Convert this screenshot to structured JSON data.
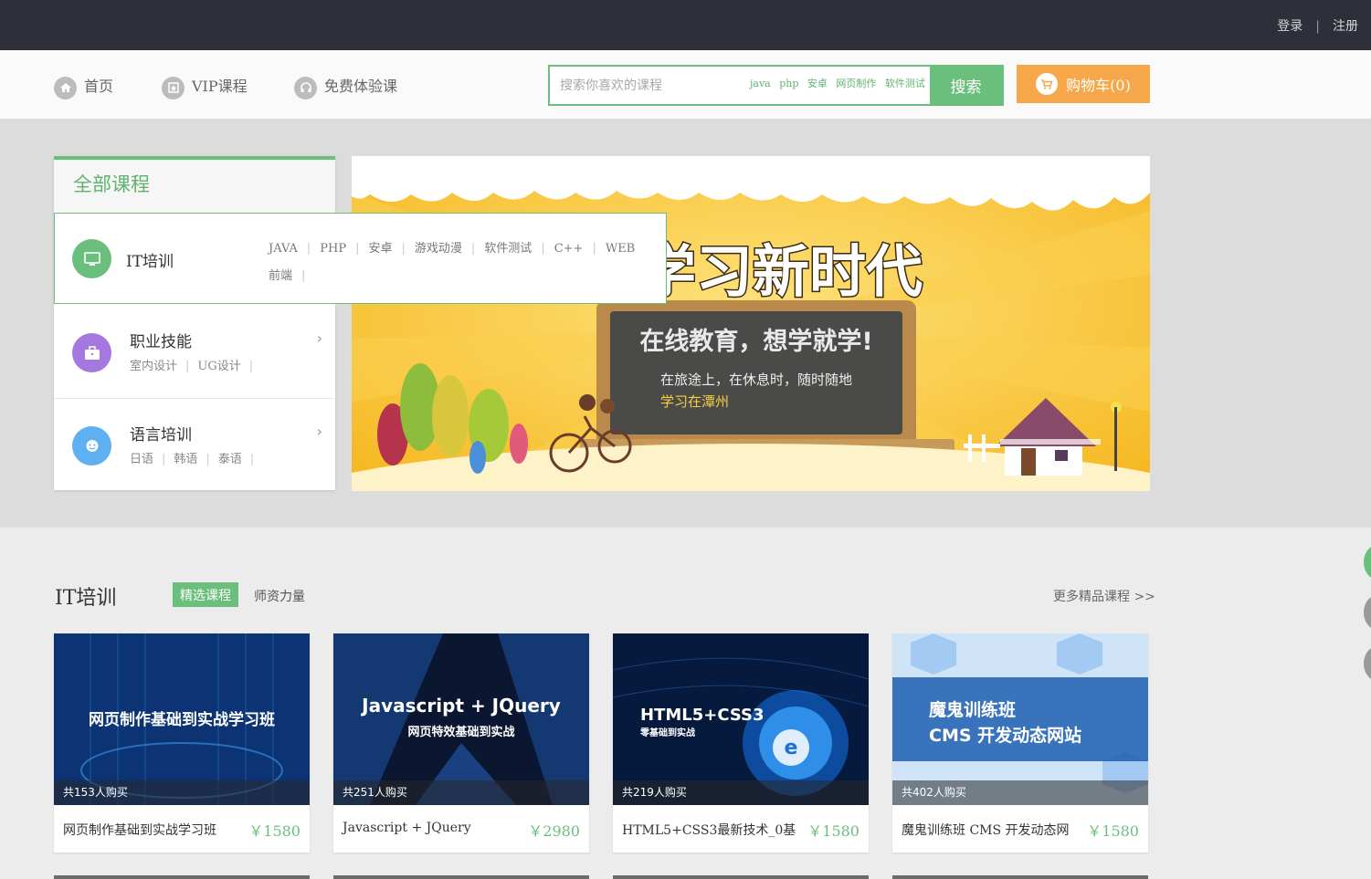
{
  "topbar": {
    "login": "登录",
    "sep": "|",
    "register": "注册"
  },
  "nav": {
    "items": [
      {
        "label": "首页",
        "icon": "home-icon"
      },
      {
        "label": "VIP课程",
        "icon": "vip-icon"
      },
      {
        "label": "免费体验课",
        "icon": "headphones-icon"
      }
    ],
    "search_placeholder": "搜索你喜欢的课程",
    "hot_words": [
      "java",
      "php",
      "安卓",
      "网页制作",
      "软件测试"
    ],
    "search_button": "搜索",
    "cart_label": "购物车(0)"
  },
  "categories": {
    "title": "全部课程",
    "it": {
      "name": "IT培训",
      "subs": [
        "JAVA",
        "PHP",
        "安卓",
        "游戏动漫",
        "软件测试",
        "C++",
        "WEB",
        "前端"
      ]
    },
    "rows": [
      {
        "name": "职业技能",
        "subs": [
          "室内设计",
          "UG设计"
        ],
        "color": "#a578e0"
      },
      {
        "name": "语言培训",
        "subs": [
          "日语",
          "韩语",
          "泰语"
        ],
        "color": "#5fb0f0"
      }
    ]
  },
  "banner": {
    "headline": "学习新时代",
    "slogan": "在线教育，想学就学!",
    "line1": "在旅途上，在休息时，随时随地",
    "line2": "学习在潭州"
  },
  "section": {
    "title": "IT培训",
    "tab_active": "精选课程",
    "tab": "师资力量",
    "more": "更多精品课程 >>"
  },
  "courses": [
    {
      "thumb_title": "网页制作基础到实战学习班",
      "thumb_sub": "",
      "buyers": "共153人购买",
      "name": "网页制作基础到实战学习班",
      "price": "￥1580"
    },
    {
      "thumb_title": "Javascript + JQuery",
      "thumb_sub": "网页特效基础到实战",
      "buyers": "共251人购买",
      "name": "Javascript + JQuery",
      "price": "￥2980"
    },
    {
      "thumb_title": "HTML5+CSS3",
      "thumb_sub": "零基础到实战",
      "buyers": "共219人购买",
      "name": "HTML5+CSS3最新技术_0基",
      "price": "￥1580"
    },
    {
      "thumb_title": "魔鬼训练班",
      "thumb_sub": "CMS 开发动态网站",
      "buyers": "共402人购买",
      "name": "魔鬼训练班 CMS 开发动态网",
      "price": "￥1580"
    }
  ],
  "colors": {
    "brand_green": "#6bbf7d",
    "cart_orange": "#f5a74a",
    "topbar": "#2e3039"
  }
}
